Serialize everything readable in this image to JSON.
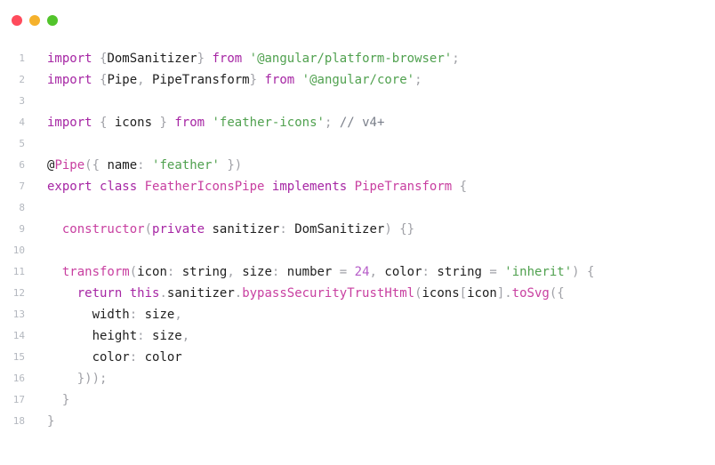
{
  "window": {
    "controls": [
      {
        "name": "close-icon",
        "color": "#ff4b5c"
      },
      {
        "name": "minimize-icon",
        "color": "#f5b12c"
      },
      {
        "name": "maximize-icon",
        "color": "#52c42b"
      }
    ]
  },
  "code": {
    "lines": [
      {
        "n": "1",
        "tokens": [
          {
            "t": "keyword",
            "v": "import"
          },
          {
            "t": "plain",
            "v": " "
          },
          {
            "t": "punct",
            "v": "{"
          },
          {
            "t": "plain",
            "v": "DomSanitizer"
          },
          {
            "t": "punct",
            "v": "}"
          },
          {
            "t": "plain",
            "v": " "
          },
          {
            "t": "keyword",
            "v": "from"
          },
          {
            "t": "plain",
            "v": " "
          },
          {
            "t": "string",
            "v": "'@angular/platform-browser'"
          },
          {
            "t": "punct",
            "v": ";"
          }
        ]
      },
      {
        "n": "2",
        "tokens": [
          {
            "t": "keyword",
            "v": "import"
          },
          {
            "t": "plain",
            "v": " "
          },
          {
            "t": "punct",
            "v": "{"
          },
          {
            "t": "plain",
            "v": "Pipe"
          },
          {
            "t": "punct",
            "v": ","
          },
          {
            "t": "plain",
            "v": " PipeTransform"
          },
          {
            "t": "punct",
            "v": "}"
          },
          {
            "t": "plain",
            "v": " "
          },
          {
            "t": "keyword",
            "v": "from"
          },
          {
            "t": "plain",
            "v": " "
          },
          {
            "t": "string",
            "v": "'@angular/core'"
          },
          {
            "t": "punct",
            "v": ";"
          }
        ]
      },
      {
        "n": "3",
        "tokens": []
      },
      {
        "n": "4",
        "tokens": [
          {
            "t": "keyword",
            "v": "import"
          },
          {
            "t": "plain",
            "v": " "
          },
          {
            "t": "punct",
            "v": "{"
          },
          {
            "t": "plain",
            "v": " icons "
          },
          {
            "t": "punct",
            "v": "}"
          },
          {
            "t": "plain",
            "v": " "
          },
          {
            "t": "keyword",
            "v": "from"
          },
          {
            "t": "plain",
            "v": " "
          },
          {
            "t": "string",
            "v": "'feather-icons'"
          },
          {
            "t": "punct",
            "v": ";"
          },
          {
            "t": "plain",
            "v": " "
          },
          {
            "t": "comment",
            "v": "// v4+"
          }
        ]
      },
      {
        "n": "5",
        "tokens": []
      },
      {
        "n": "6",
        "tokens": [
          {
            "t": "decorator",
            "v": "@"
          },
          {
            "t": "class",
            "v": "Pipe"
          },
          {
            "t": "punct",
            "v": "({"
          },
          {
            "t": "plain",
            "v": " name"
          },
          {
            "t": "punct",
            "v": ":"
          },
          {
            "t": "plain",
            "v": " "
          },
          {
            "t": "string",
            "v": "'feather'"
          },
          {
            "t": "plain",
            "v": " "
          },
          {
            "t": "punct",
            "v": "})"
          }
        ]
      },
      {
        "n": "7",
        "tokens": [
          {
            "t": "keyword",
            "v": "export"
          },
          {
            "t": "plain",
            "v": " "
          },
          {
            "t": "keyword",
            "v": "class"
          },
          {
            "t": "plain",
            "v": " "
          },
          {
            "t": "class",
            "v": "FeatherIconsPipe"
          },
          {
            "t": "plain",
            "v": " "
          },
          {
            "t": "keyword",
            "v": "implements"
          },
          {
            "t": "plain",
            "v": " "
          },
          {
            "t": "class",
            "v": "PipeTransform"
          },
          {
            "t": "plain",
            "v": " "
          },
          {
            "t": "punct",
            "v": "{"
          }
        ]
      },
      {
        "n": "8",
        "tokens": []
      },
      {
        "n": "9",
        "tokens": [
          {
            "t": "plain",
            "v": "  "
          },
          {
            "t": "func",
            "v": "constructor"
          },
          {
            "t": "punct",
            "v": "("
          },
          {
            "t": "keyword",
            "v": "private"
          },
          {
            "t": "plain",
            "v": " sanitizer"
          },
          {
            "t": "punct",
            "v": ":"
          },
          {
            "t": "plain",
            "v": " DomSanitizer"
          },
          {
            "t": "punct",
            "v": ")"
          },
          {
            "t": "plain",
            "v": " "
          },
          {
            "t": "punct",
            "v": "{}"
          }
        ]
      },
      {
        "n": "10",
        "tokens": []
      },
      {
        "n": "11",
        "tokens": [
          {
            "t": "plain",
            "v": "  "
          },
          {
            "t": "func",
            "v": "transform"
          },
          {
            "t": "punct",
            "v": "("
          },
          {
            "t": "plain",
            "v": "icon"
          },
          {
            "t": "punct",
            "v": ":"
          },
          {
            "t": "plain",
            "v": " string"
          },
          {
            "t": "punct",
            "v": ","
          },
          {
            "t": "plain",
            "v": " size"
          },
          {
            "t": "punct",
            "v": ":"
          },
          {
            "t": "plain",
            "v": " number "
          },
          {
            "t": "punct",
            "v": "="
          },
          {
            "t": "plain",
            "v": " "
          },
          {
            "t": "number",
            "v": "24"
          },
          {
            "t": "punct",
            "v": ","
          },
          {
            "t": "plain",
            "v": " color"
          },
          {
            "t": "punct",
            "v": ":"
          },
          {
            "t": "plain",
            "v": " string "
          },
          {
            "t": "punct",
            "v": "="
          },
          {
            "t": "plain",
            "v": " "
          },
          {
            "t": "string",
            "v": "'inherit'"
          },
          {
            "t": "punct",
            "v": ")"
          },
          {
            "t": "plain",
            "v": " "
          },
          {
            "t": "punct",
            "v": "{"
          }
        ]
      },
      {
        "n": "12",
        "tokens": [
          {
            "t": "plain",
            "v": "    "
          },
          {
            "t": "keyword",
            "v": "return"
          },
          {
            "t": "plain",
            "v": " "
          },
          {
            "t": "keyword",
            "v": "this"
          },
          {
            "t": "punct",
            "v": "."
          },
          {
            "t": "plain",
            "v": "sanitizer"
          },
          {
            "t": "punct",
            "v": "."
          },
          {
            "t": "func",
            "v": "bypassSecurityTrustHtml"
          },
          {
            "t": "punct",
            "v": "("
          },
          {
            "t": "plain",
            "v": "icons"
          },
          {
            "t": "punct",
            "v": "["
          },
          {
            "t": "plain",
            "v": "icon"
          },
          {
            "t": "punct",
            "v": "]."
          },
          {
            "t": "func",
            "v": "toSvg"
          },
          {
            "t": "punct",
            "v": "({"
          }
        ]
      },
      {
        "n": "13",
        "tokens": [
          {
            "t": "plain",
            "v": "      width"
          },
          {
            "t": "punct",
            "v": ":"
          },
          {
            "t": "plain",
            "v": " size"
          },
          {
            "t": "punct",
            "v": ","
          }
        ]
      },
      {
        "n": "14",
        "tokens": [
          {
            "t": "plain",
            "v": "      height"
          },
          {
            "t": "punct",
            "v": ":"
          },
          {
            "t": "plain",
            "v": " size"
          },
          {
            "t": "punct",
            "v": ","
          }
        ]
      },
      {
        "n": "15",
        "tokens": [
          {
            "t": "plain",
            "v": "      color"
          },
          {
            "t": "punct",
            "v": ":"
          },
          {
            "t": "plain",
            "v": " color"
          }
        ]
      },
      {
        "n": "16",
        "tokens": [
          {
            "t": "plain",
            "v": "    "
          },
          {
            "t": "punct",
            "v": "}));"
          }
        ]
      },
      {
        "n": "17",
        "tokens": [
          {
            "t": "plain",
            "v": "  "
          },
          {
            "t": "punct",
            "v": "}"
          }
        ]
      },
      {
        "n": "18",
        "tokens": [
          {
            "t": "punct",
            "v": "}"
          }
        ]
      }
    ]
  }
}
